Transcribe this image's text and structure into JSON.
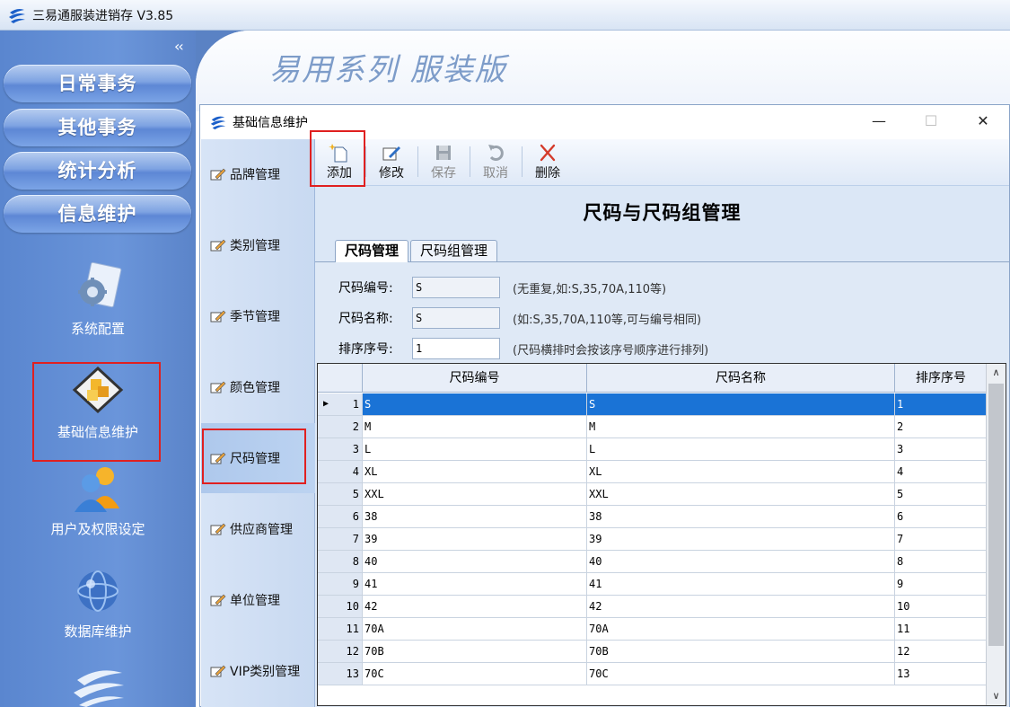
{
  "app": {
    "title": "三易通服装进销存 V3.85",
    "banner_text": "易用系列 服装版",
    "collapse": "‹‹"
  },
  "sidebar": {
    "nav_buttons": [
      "日常事务",
      "其他事务",
      "统计分析",
      "信息维护"
    ],
    "tools": [
      {
        "label": "系统配置",
        "icon": "system-config-icon"
      },
      {
        "label": "基础信息维护",
        "icon": "basic-info-icon",
        "selected": true
      },
      {
        "label": "用户及权限设定",
        "icon": "users-icon"
      },
      {
        "label": "数据库维护",
        "icon": "database-globe-icon"
      }
    ]
  },
  "window": {
    "title": "基础信息维护",
    "minimize": "—",
    "maximize": "☐",
    "close": "✕"
  },
  "inner_nav": {
    "items": [
      "品牌管理",
      "类别管理",
      "季节管理",
      "颜色管理",
      "尺码管理",
      "供应商管理",
      "单位管理",
      "VIP类别管理"
    ],
    "active_index": 4
  },
  "toolbar": {
    "add": "添加",
    "edit": "修改",
    "save": "保存",
    "cancel": "取消",
    "delete": "删除"
  },
  "heading": "尺码与尺码组管理",
  "tabs": [
    "尺码管理",
    "尺码组管理"
  ],
  "form": {
    "code_label": "尺码编号:",
    "code_value": "S",
    "code_hint": "(无重复,如:S,35,70A,110等)",
    "name_label": "尺码名称:",
    "name_value": "S",
    "name_hint": "(如:S,35,70A,110等,可与编号相同)",
    "order_label": "排序序号:",
    "order_value": "1",
    "order_hint": "(尺码横排时会按该序号顺序进行排列)"
  },
  "grid": {
    "columns": [
      "尺码编号",
      "尺码名称",
      "排序序号"
    ],
    "rows": [
      [
        "1",
        "S",
        "S",
        "1"
      ],
      [
        "2",
        "M",
        "M",
        "2"
      ],
      [
        "3",
        "L",
        "L",
        "3"
      ],
      [
        "4",
        "XL",
        "XL",
        "4"
      ],
      [
        "5",
        "XXL",
        "XXL",
        "5"
      ],
      [
        "6",
        "38",
        "38",
        "6"
      ],
      [
        "7",
        "39",
        "39",
        "7"
      ],
      [
        "8",
        "40",
        "40",
        "8"
      ],
      [
        "9",
        "41",
        "41",
        "9"
      ],
      [
        "10",
        "42",
        "42",
        "10"
      ],
      [
        "11",
        "70A",
        "70A",
        "11"
      ],
      [
        "12",
        "70B",
        "70B",
        "12"
      ],
      [
        "13",
        "70C",
        "70C",
        "13"
      ]
    ],
    "selected_row": 0,
    "scroll_up": "∧",
    "scroll_down": "∨"
  },
  "colors": {
    "accent": "#1a73d6",
    "sidebar": "#5a86cf",
    "highlight_box": "#e02020"
  }
}
